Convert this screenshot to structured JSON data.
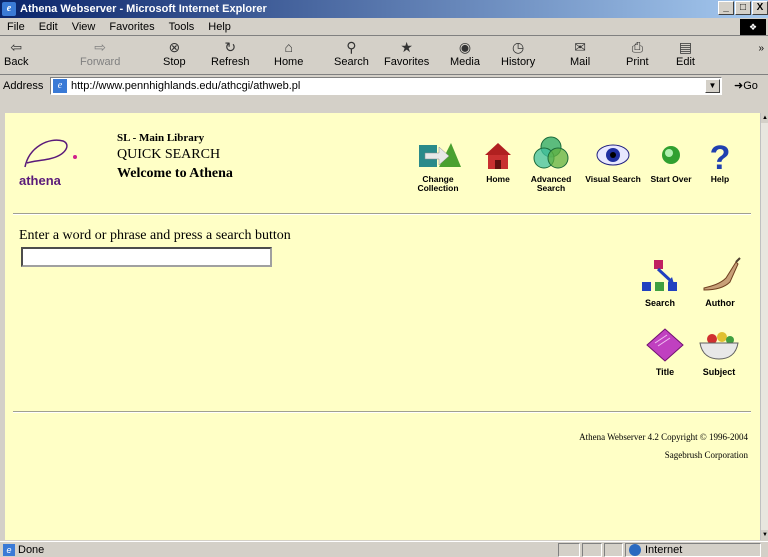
{
  "window": {
    "title": "Athena Webserver - Microsoft Internet Explorer",
    "controls": [
      "_",
      "□",
      "X"
    ]
  },
  "menu": [
    "File",
    "Edit",
    "View",
    "Favorites",
    "Tools",
    "Help"
  ],
  "toolbar": {
    "back": "Back",
    "forward": "Forward",
    "stop": "Stop",
    "refresh": "Refresh",
    "home": "Home",
    "search": "Search",
    "favorites": "Favorites",
    "media": "Media",
    "history": "History",
    "mail": "Mail",
    "print": "Print",
    "edit": "Edit"
  },
  "address": {
    "label": "Address",
    "url": "http://www.pennhighlands.edu/athcgi/athweb.pl",
    "go": "Go"
  },
  "page": {
    "logo_text": "athena",
    "library": "SL - Main Library",
    "mode": "QUICK SEARCH",
    "welcome": "Welcome to Athena",
    "nav": {
      "change_collection": "Change Collection",
      "home": "Home",
      "advanced_search": "Advanced Search",
      "visual_search": "Visual Search",
      "start_over": "Start Over",
      "help": "Help"
    },
    "prompt": "Enter a word or phrase and press a search button",
    "search_value": "",
    "search_buttons": {
      "search": "Search",
      "author": "Author",
      "title": "Title",
      "subject": "Subject"
    },
    "footer_line1": "Athena Webserver 4.2 Copyright © 1996-2004",
    "footer_line2": "Sagebrush Corporation"
  },
  "status": {
    "text": "Done",
    "zone": "Internet"
  },
  "colors": {
    "page_bg": "#ffffc6",
    "titlebar": "#0a246a",
    "logo_purple": "#5a1a7a",
    "logo_pink": "#d0208a"
  }
}
